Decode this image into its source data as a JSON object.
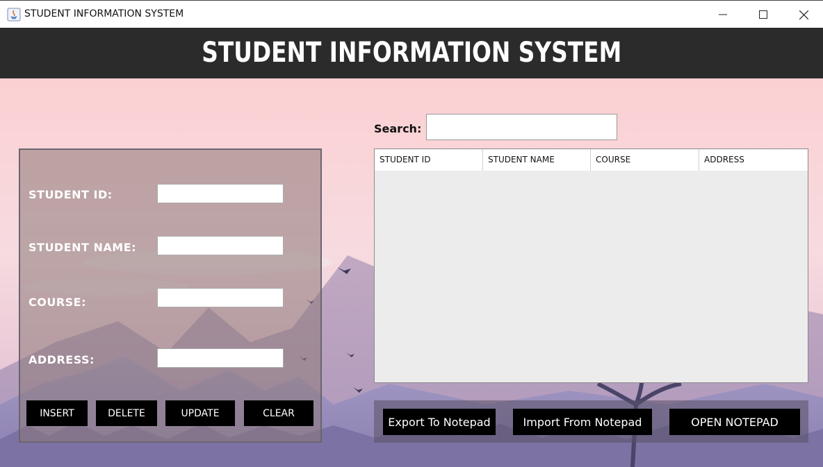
{
  "window": {
    "title": "STUDENT INFORMATION SYSTEM",
    "controls": {
      "minimize": "minimize-icon",
      "maximize": "maximize-icon",
      "close": "close-icon"
    }
  },
  "header": {
    "title": "STUDENT INFORMATION SYSTEM"
  },
  "form": {
    "student_id_label": "STUDENT ID:",
    "student_name_label": "STUDENT NAME:",
    "course_label": "COURSE:",
    "address_label": "ADDRESS:",
    "student_id_value": "",
    "student_name_value": "",
    "course_value": "",
    "address_value": ""
  },
  "actions": {
    "insert": "INSERT",
    "delete": "DELETE",
    "update": "UPDATE",
    "clear": "CLEAR"
  },
  "search": {
    "label": "Search:",
    "value": ""
  },
  "table": {
    "columns": [
      "STUDENT ID",
      "STUDENT NAME",
      "COURSE",
      "ADDRESS"
    ],
    "rows": []
  },
  "file_actions": {
    "export": "Export To Notepad",
    "import": "Import From Notepad",
    "open": "OPEN NOTEPAD"
  },
  "colors": {
    "header_bg": "#2b2b2b",
    "button_bg": "#000000",
    "sky_top": "#fbd1d3",
    "mountain": "#9a8fb8"
  }
}
